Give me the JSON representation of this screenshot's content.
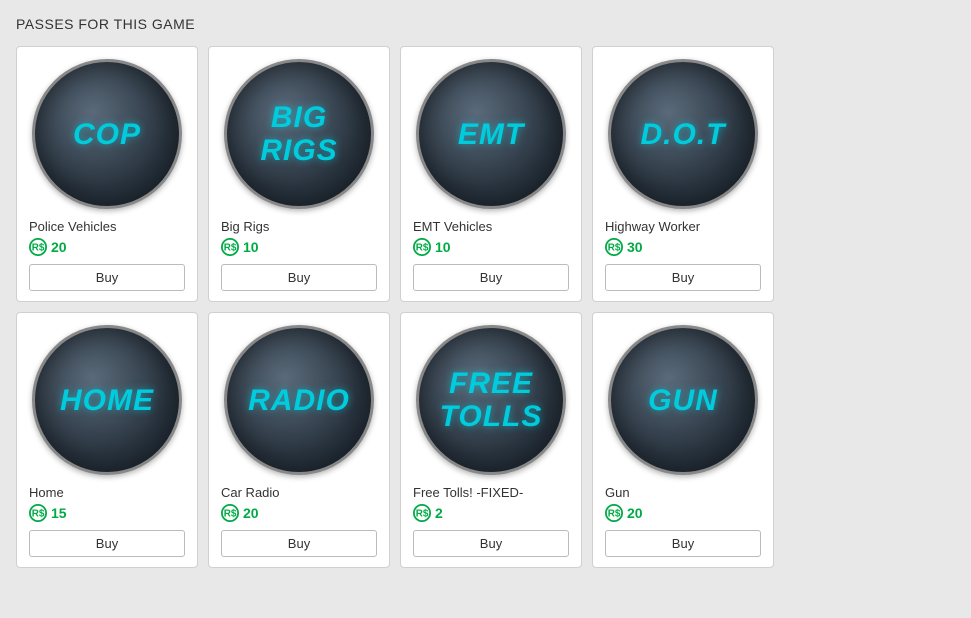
{
  "page": {
    "title": "PASSES FOR THIS GAME"
  },
  "passes": [
    {
      "id": "cop",
      "icon_text": "COP",
      "name": "Police Vehicles",
      "price": 20,
      "buy_label": "Buy"
    },
    {
      "id": "big-rigs",
      "icon_text": "BIG\nRIGS",
      "name": "Big Rigs",
      "price": 10,
      "buy_label": "Buy"
    },
    {
      "id": "emt",
      "icon_text": "EMT",
      "name": "EMT Vehicles",
      "price": 10,
      "buy_label": "Buy"
    },
    {
      "id": "dot",
      "icon_text": "D.O.T",
      "name": "Highway Worker",
      "price": 30,
      "buy_label": "Buy"
    },
    {
      "id": "home",
      "icon_text": "HOME",
      "name": "Home",
      "price": 15,
      "buy_label": "Buy"
    },
    {
      "id": "radio",
      "icon_text": "RADIO",
      "name": "Car Radio",
      "price": 20,
      "buy_label": "Buy"
    },
    {
      "id": "free-tolls",
      "icon_text": "FREE\nTOLLS",
      "name": "Free Tolls! -FIXED-",
      "price": 2,
      "buy_label": "Buy"
    },
    {
      "id": "gun",
      "icon_text": "GUN",
      "name": "Gun",
      "price": 20,
      "buy_label": "Buy"
    }
  ]
}
